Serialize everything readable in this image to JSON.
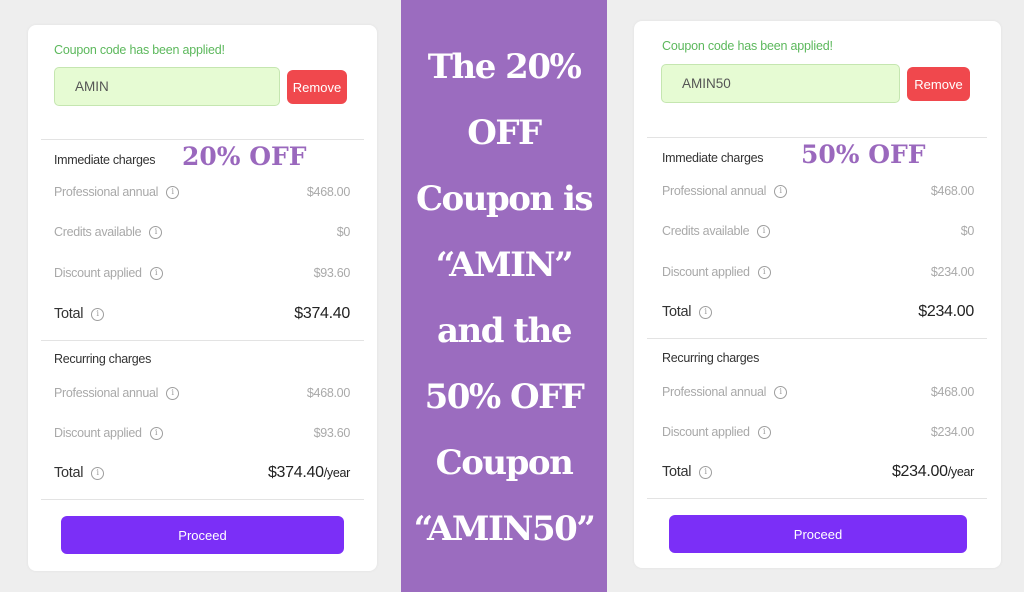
{
  "colors": {
    "page_bg": "#eeeeee",
    "banner_bg": "#9b6cbf",
    "success_text": "#5cb85c",
    "coupon_input_bg": "#e6fbd3",
    "remove_button": "#f0484d",
    "proceed_button": "#7b2ff7",
    "off_label": "#9a68bd"
  },
  "banner": {
    "lines": [
      "The 20%",
      "OFF",
      "Coupon is",
      "“AMIN”",
      "and the",
      "50% OFF",
      "Coupon",
      "“AMIN50”"
    ]
  },
  "cards": [
    {
      "applied_message": "Coupon code has been applied!",
      "coupon_value": "AMIN",
      "remove_label": "Remove",
      "off_label": "20% OFF",
      "immediate": {
        "title": "Immediate charges",
        "rows": [
          {
            "label": "Professional annual",
            "value": "$468.00",
            "icon": "info-icon"
          },
          {
            "label": "Credits available",
            "value": "$0",
            "icon": "info-icon"
          },
          {
            "label": "Discount applied",
            "value": "$93.60",
            "icon": "info-icon"
          }
        ],
        "total_label": "Total",
        "total_value": "$374.40"
      },
      "recurring": {
        "title": "Recurring charges",
        "rows": [
          {
            "label": "Professional annual",
            "value": "$468.00",
            "icon": "info-icon"
          },
          {
            "label": "Discount applied",
            "value": "$93.60",
            "icon": "info-icon"
          }
        ],
        "total_label": "Total",
        "total_value": "$374.40",
        "total_period": "/year"
      },
      "proceed_label": "Proceed"
    },
    {
      "applied_message": "Coupon code has been applied!",
      "coupon_value": "AMIN50",
      "remove_label": "Remove",
      "off_label": "50% OFF",
      "immediate": {
        "title": "Immediate charges",
        "rows": [
          {
            "label": "Professional annual",
            "value": "$468.00",
            "icon": "info-icon"
          },
          {
            "label": "Credits available",
            "value": "$0",
            "icon": "info-icon"
          },
          {
            "label": "Discount applied",
            "value": "$234.00",
            "icon": "info-icon"
          }
        ],
        "total_label": "Total",
        "total_value": "$234.00"
      },
      "recurring": {
        "title": "Recurring charges",
        "rows": [
          {
            "label": "Professional annual",
            "value": "$468.00",
            "icon": "info-icon"
          },
          {
            "label": "Discount applied",
            "value": "$234.00",
            "icon": "info-icon"
          }
        ],
        "total_label": "Total",
        "total_value": "$234.00",
        "total_period": "/year"
      },
      "proceed_label": "Proceed"
    }
  ]
}
